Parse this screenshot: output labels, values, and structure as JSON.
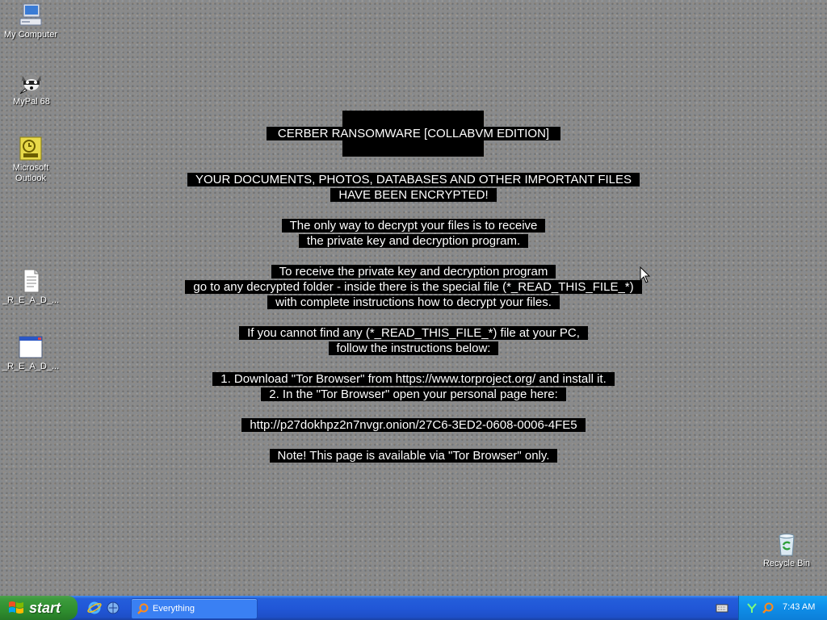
{
  "desktop": {
    "icons": [
      {
        "label": "My Computer",
        "icon": "my-computer-icon"
      },
      {
        "label": "MyPal 68",
        "icon": "mypal-browser-icon"
      },
      {
        "label": "Microsoft Outlook",
        "icon": "outlook-icon"
      },
      {
        "label": "_R_E_A_D_...",
        "icon": "text-file-icon"
      },
      {
        "label": "_R_E_A_D_...",
        "icon": "html-file-icon"
      },
      {
        "label": "Recycle Bin",
        "icon": "recycle-bin-icon"
      }
    ]
  },
  "note": {
    "title": " CERBER RANSOMWARE [COLLABVM EDITION] ",
    "lines": [
      "YOUR DOCUMENTS, PHOTOS, DATABASES AND OTHER IMPORTANT FILES",
      "HAVE BEEN ENCRYPTED!",
      "The only way to decrypt your files is to receive",
      "the private key and decryption program.",
      "To receive the private key and decryption program",
      "go to any decrypted folder - inside there is the special file (*_READ_THIS_FILE_*)",
      "with complete instructions how to decrypt your files.",
      "If you cannot find any (*_READ_THIS_FILE_*) file at your PC,",
      "follow the instructions below:",
      "1. Download \"Tor Browser\" from https://www.torproject.org/ and install it.",
      "2. In the \"Tor Browser\" open your personal page here:",
      "http://p27dokhpz2n7nvgr.onion/27C6-3ED2-0608-0006-4FE5",
      "Note! This page is available via \"Tor Browser\" only."
    ]
  },
  "taskbar": {
    "start_label": "start",
    "quick_launch": [
      "internet-explorer-icon",
      "browser-icon"
    ],
    "tasks": [
      {
        "label": "Everything",
        "icon": "search-icon"
      }
    ],
    "tray": {
      "icons": [
        "network-icon",
        "search-icon"
      ],
      "clock": "7:43 AM"
    }
  },
  "colors": {
    "note_bg": "#000000",
    "note_text": "#ffffff",
    "taskbar_blue": "#245edb",
    "start_green": "#3c9b3c"
  }
}
